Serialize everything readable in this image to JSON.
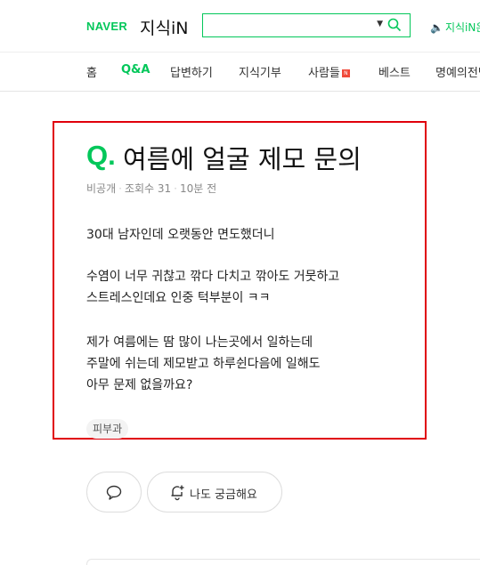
{
  "header": {
    "brand": "NAVER",
    "service": "지식iN",
    "search": {
      "placeholder": "",
      "value": ""
    },
    "promo": "지식iN은"
  },
  "nav": {
    "items": [
      {
        "label": "홈",
        "active": false
      },
      {
        "label": "Q&A",
        "active": true
      },
      {
        "label": "답변하기",
        "active": false
      },
      {
        "label": "지식기부",
        "active": false
      },
      {
        "label": "사람들",
        "active": false,
        "badge": "N"
      },
      {
        "label": "베스트",
        "active": false
      },
      {
        "label": "명예의전당",
        "active": false
      }
    ]
  },
  "question": {
    "q_mark": "Q.",
    "title": "여름에 얼굴 제모 문의",
    "meta": {
      "visibility": "비공개",
      "views": "조회수 31",
      "time": "10분 전"
    },
    "body": [
      "30대 남자인데 오랫동안 면도했더니",
      "",
      "수염이 너무 귀찮고 깎다 다치고 깎아도 거뭇하고",
      "스트레스인데요 인중 턱부분이 ㅋㅋ",
      "",
      "제가 여름에는 땀 많이 나는곳에서 일하는데",
      "주말에 쉬는데 제모받고 하루쉰다음에 일해도",
      "아무 문제 없을까요?"
    ],
    "tag": "피부과"
  },
  "actions": {
    "curious_label": "나도 궁금해요"
  },
  "colors": {
    "brand": "#03c75a",
    "highlight": "#e0000b"
  }
}
